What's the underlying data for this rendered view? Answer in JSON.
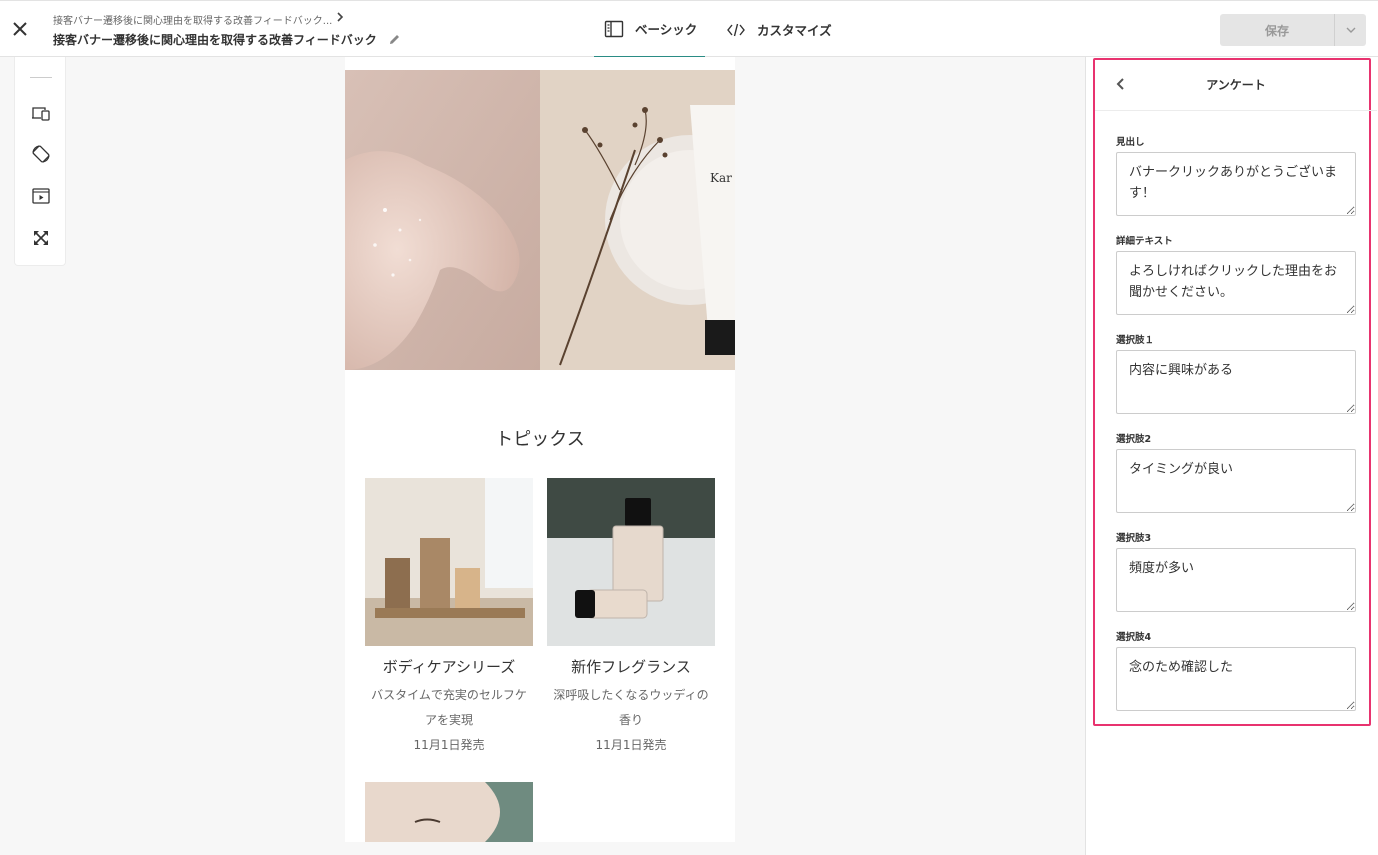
{
  "header": {
    "breadcrumb_parent": "接客バナー遷移後に関心理由を取得する改善フィードバック...",
    "title": "接客バナー遷移後に関心理由を取得する改善フィードバック",
    "tabs": [
      {
        "label": "ベーシック",
        "icon": "layout-columns-icon",
        "active": true
      },
      {
        "label": "カスタマイズ",
        "icon": "code-icon",
        "active": false
      }
    ],
    "save_label": "保存"
  },
  "toolbar": {
    "icons": [
      "device-switch-icon",
      "rotate-icon",
      "play-icon",
      "fullscreen-icon"
    ]
  },
  "preview": {
    "topics_title": "トピックス",
    "cards": [
      {
        "title": "ボディケアシリーズ",
        "desc": "バスタイムで充実のセルフケアを実現",
        "date": "11月1日発売"
      },
      {
        "title": "新作フレグランス",
        "desc": "深呼吸したくなるウッディの香り",
        "date": "11月1日発売"
      }
    ],
    "bottle_text": "Kar"
  },
  "panel": {
    "title": "アンケート",
    "fields": [
      {
        "label": "見出し",
        "value": "バナークリックありがとうございます！"
      },
      {
        "label": "詳細テキスト",
        "value": "よろしければクリックした理由をお聞かせください。"
      },
      {
        "label": "選択肢１",
        "value": "内容に興味がある"
      },
      {
        "label": "選択肢2",
        "value": "タイミングが良い"
      },
      {
        "label": "選択肢3",
        "value": "頻度が多い"
      },
      {
        "label": "選択肢4",
        "value": "念のため確認した"
      }
    ]
  },
  "colors": {
    "accent": "#2a8c85",
    "highlight": "#e8336f"
  }
}
